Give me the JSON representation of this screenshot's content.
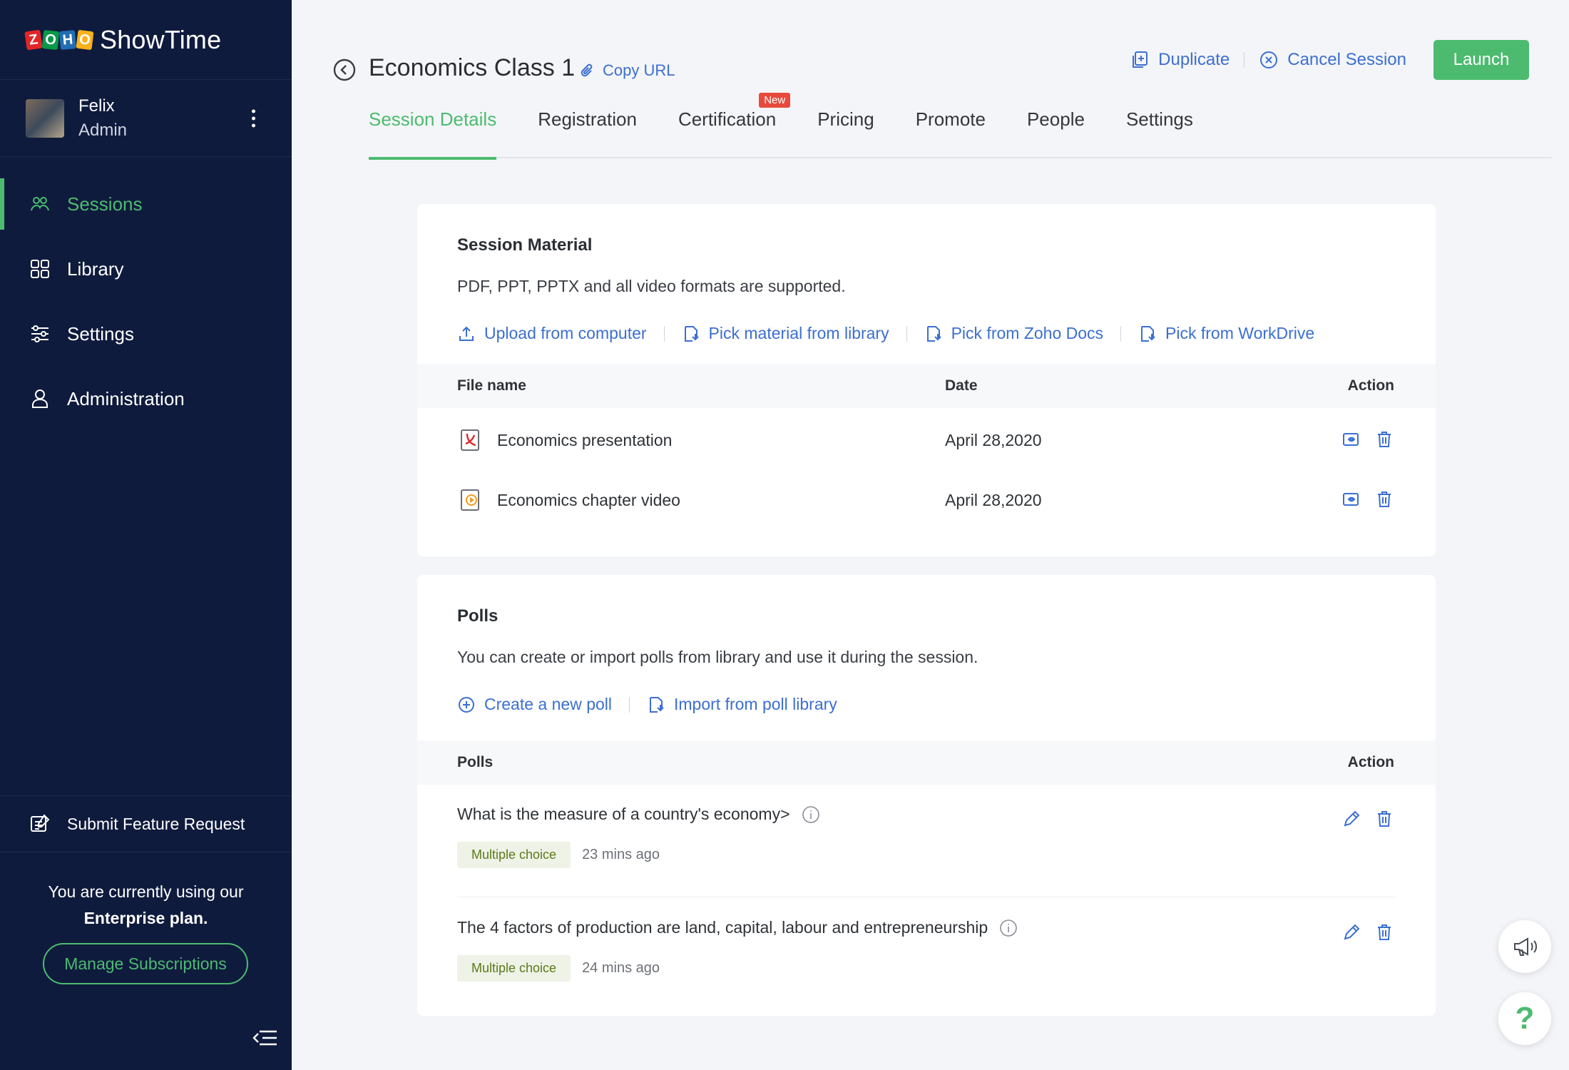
{
  "brand": {
    "logo_letters": [
      "Z",
      "O",
      "H",
      "O"
    ],
    "name": "ShowTime"
  },
  "user": {
    "name": "Felix",
    "role": "Admin"
  },
  "nav": {
    "items": [
      {
        "label": "Sessions",
        "icon": "sessions-icon",
        "active": true
      },
      {
        "label": "Library",
        "icon": "library-icon"
      },
      {
        "label": "Settings",
        "icon": "settings-icon"
      },
      {
        "label": "Administration",
        "icon": "administration-icon"
      }
    ]
  },
  "sidebar_footer": {
    "feature_request": "Submit Feature Request",
    "plan_text_1": "You are currently using our",
    "plan_text_2": "Enterprise plan.",
    "manage_label": "Manage Subscriptions"
  },
  "header": {
    "title": "Economics Class 1",
    "copy_url": "Copy URL",
    "duplicate": "Duplicate",
    "cancel": "Cancel Session",
    "launch": "Launch"
  },
  "tabs": [
    {
      "label": "Session Details",
      "active": true
    },
    {
      "label": "Registration"
    },
    {
      "label": "Certification",
      "badge": "New"
    },
    {
      "label": "Pricing"
    },
    {
      "label": "Promote"
    },
    {
      "label": "People"
    },
    {
      "label": "Settings"
    }
  ],
  "material": {
    "title": "Session Material",
    "description": "PDF, PPT, PPTX and all video formats are supported.",
    "links": {
      "upload": "Upload from computer",
      "library": "Pick material from library",
      "docs": "Pick from Zoho Docs",
      "workdrive": "Pick from WorkDrive"
    },
    "columns": {
      "file": "File name",
      "date": "Date",
      "action": "Action"
    },
    "files": [
      {
        "name": "Economics presentation",
        "date": "April 28,2020",
        "type": "pdf"
      },
      {
        "name": "Economics chapter video",
        "date": "April 28,2020",
        "type": "video"
      }
    ]
  },
  "polls": {
    "title": "Polls",
    "description": "You can create or import polls from library and use it during the session.",
    "links": {
      "create": "Create a new poll",
      "import": "Import from poll library"
    },
    "columns": {
      "polls": "Polls",
      "action": "Action"
    },
    "items": [
      {
        "question": "What is the measure of a country's economy>",
        "type": "Multiple choice",
        "ago": "23 mins ago"
      },
      {
        "question": "The 4 factors of production are land, capital, labour and entrepreneurship",
        "type": "Multiple choice",
        "ago": "24 mins ago"
      }
    ]
  },
  "colors": {
    "sidebar": "#0f1b3d",
    "accent": "#4cbb70",
    "link": "#3c6fd1",
    "badge": "#e74a3c"
  }
}
